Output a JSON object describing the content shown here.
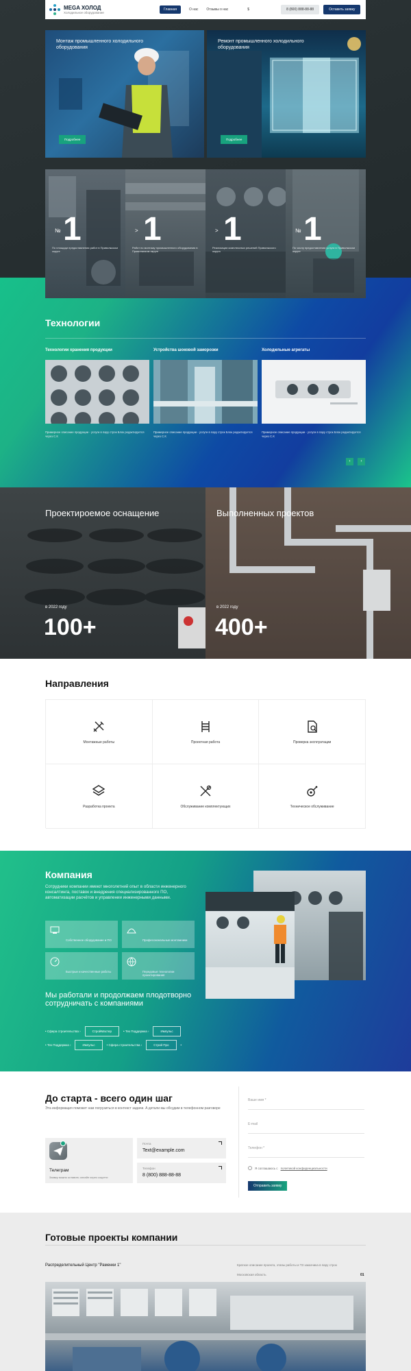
{
  "header": {
    "logo_name": "MEGA ХОЛОД",
    "logo_sub": "Холодильное оборудование",
    "nav": [
      "Главная",
      "О нас",
      "Отзывы о нас"
    ],
    "nav_extra": "$",
    "phone": "8 (800) 888-88-88",
    "cta": "Оставить заявку"
  },
  "hero": {
    "cards": [
      {
        "title": "Монтаж промышленного холодильного оборудования",
        "button": "Подробнее"
      },
      {
        "title": "Ремонт промышленного холодильного оборудования",
        "button": "Подробнее"
      }
    ]
  },
  "stats": [
    {
      "prefix": "№",
      "value": "1",
      "text": "По площади предоставления работ в Приволжском округе"
    },
    {
      "prefix": ">",
      "value": "1",
      "text": "Работ по монтажу промышленного оборудования в Приволжском округе"
    },
    {
      "prefix": ">",
      "value": "1",
      "text": "Реализации комплексных решений Приволжского округа"
    },
    {
      "prefix": "№",
      "value": "1",
      "text": "По числу предоставления услуги в Приволжском округе"
    }
  ],
  "technologies": {
    "heading": "Технологии",
    "items": [
      {
        "title": "Технологии хранения продукции",
        "desc": "Примерное описание продукции - услуги в пару строк Блок редактируется через С.К"
      },
      {
        "title": "Устройства шоковой заморозки",
        "desc": "Примерное описание продукции - услуги в пару строк Блок редактируется через С.К"
      },
      {
        "title": "Холодильные агрегаты",
        "desc": "Примерное описание продукции - услуги в пару строк Блок редактируется через С.К"
      }
    ],
    "prev": "‹",
    "next": "›"
  },
  "numbers": [
    {
      "title": "Проектироемое оснащение",
      "sub": "в 2022 году",
      "value": "100+"
    },
    {
      "title": "Выполненных проектов",
      "sub": "в 2022 году",
      "value": "400+"
    }
  ],
  "directions": {
    "heading": "Направления",
    "items": [
      {
        "label": "Монтажные работы",
        "icon": "tools-icon"
      },
      {
        "label": "Проектная работа",
        "icon": "ladder-icon"
      },
      {
        "label": "Проверка эксплуатации",
        "icon": "document-search-icon"
      },
      {
        "label": "Разработка проекта",
        "icon": "layers-icon"
      },
      {
        "label": "Обслуживание комплектующих",
        "icon": "wrench-screwdriver-icon"
      },
      {
        "label": "Техническое обслуживание",
        "icon": "gear-key-icon"
      }
    ]
  },
  "company": {
    "heading": "Компания",
    "text": "Сотрудники компании имеют многолетний опыт в области инженерного консалтинга, поставок и внедрения специализированного ПО, автоматизации расчётов и управлении инженерными данными.",
    "features": [
      {
        "label": "Собственное оборудование и ПО"
      },
      {
        "label": "Профессиональные монтажники"
      },
      {
        "label": "Быстрые и качественные работы"
      },
      {
        "label": "Передовые технологии проектирования"
      }
    ],
    "partners_heading": "Мы работали и продолжаем плодотворно сотрудничать с компаниями",
    "partners_row1": [
      "Сфера строительства",
      "СтройМастер",
      "Тех Поддержка",
      "Импульс"
    ],
    "partners_row2": [
      "Тех Поддержка",
      "Импульс",
      "Сфера строительства",
      "Строй Про"
    ]
  },
  "contact": {
    "heading": "До старта - всего один шаг",
    "sub": "Эта информация поможет нам погрузиться в контекст задачи. А детали мы обсудим в телефонном разговоре",
    "telegram_title": "Телеграм",
    "telegram_sub": "Заявку можно оставить онлайн через соцсети",
    "mail_label": "Почта",
    "mail_value": "Text@example.com",
    "phone_label": "Телефон",
    "phone_value": "8 (800) 888-88-88",
    "form_name": "Ваше имя *",
    "form_email": "E-mail",
    "form_phone": "Телефон *",
    "consent": "Я соглашаюсь с",
    "consent_link": "политикой конфиденциальности",
    "submit": "Отправить заявку"
  },
  "projects": {
    "heading": "Готовые проекты компании",
    "project_title": "Распределительный Центр \"Раменки 1\"",
    "project_desc": "Краткое описание проекта, этапы работы и ТЗ заказчика в пару строк",
    "location": "Московская область",
    "counter": "01"
  },
  "colors": {
    "accent_green": "#18a27e",
    "brand_blue": "#15386e",
    "gradient_blue": "#123d9f"
  }
}
